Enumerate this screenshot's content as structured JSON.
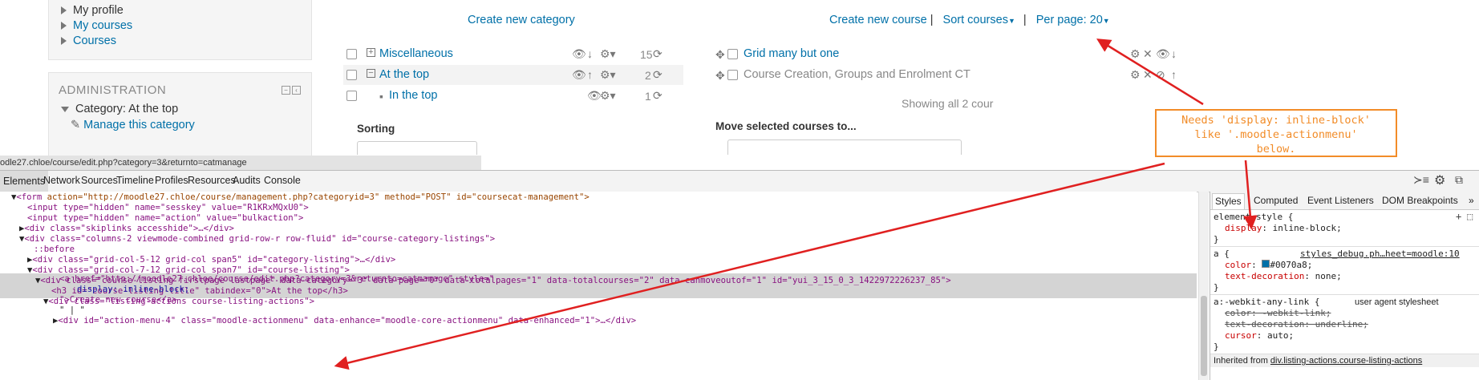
{
  "nav": {
    "items": [
      "My profile",
      "My courses",
      "Courses"
    ]
  },
  "admin": {
    "title": "ADMINISTRATION",
    "category_item": "Category: At the top",
    "manage_link": "Manage this category"
  },
  "categories": {
    "create_link": "Create new category",
    "rows": [
      {
        "name": "Miscellaneous",
        "count": "15"
      },
      {
        "name": "At the top",
        "count": "2"
      },
      {
        "name": "In the top",
        "count": "1"
      }
    ],
    "sorting_label": "Sorting"
  },
  "courses": {
    "create_link": "Create new course",
    "sep1": "|",
    "sort_link": "Sort courses",
    "sep2": "|",
    "perpage_link": "Per page: 20",
    "rows": [
      {
        "name": "Grid many but one"
      },
      {
        "name": "Course Creation, Groups and Enrolment CT"
      }
    ],
    "showing_text": "Showing all 2 cour",
    "move_label": "Move selected courses to..."
  },
  "annotation": {
    "text_line1": "Needs 'display: inline-block'",
    "text_line2": "like '.moodle-actionmenu'",
    "text_line3": "below.",
    "arrow_color": "#e02020",
    "border_color": "#f28c28"
  },
  "devtools": {
    "url": "odle27.chloe/course/edit.php?category=3&returnto=catmanage",
    "tabs": [
      "Elements",
      "Network",
      "Sources",
      "Timeline",
      "Profiles",
      "Resources",
      "Audits",
      "Console"
    ],
    "code": {
      "l1_tag": "<form",
      "l1_attr": " action=\"http://moodle27.chloe/course/management.php?categoryid=3\" method=\"POST\" id=\"coursecat-management\">",
      "l2": "<input type=\"hidden\" name=\"sesskey\" value=\"R1KRxMQxU0\">",
      "l3": "<input type=\"hidden\" name=\"action\" value=\"bulkaction\">",
      "l4": "<div class=\"skiplinks accesshide\">…</div>",
      "l5": "<div class=\"columns-2 viewmode-combined grid-row-r row-fluid\" id=\"course-category-listings\">",
      "l6": "::before",
      "l7": "<div class=\"grid-col-5-12 grid-col span5\" id=\"category-listing\">…</div>",
      "l8": "<div class=\"grid-col-7-12 grid-col span7\" id=\"course-listing\">",
      "l9": "<div class=\"course-listing firstpage lastpage\" data-category=\"3\" data-page=\"0\" data-totalpages=\"1\" data-totalcourses=\"2\" data-canmoveoutof=\"1\" id=\"yui_3_15_0_3_1422972226237_85\">",
      "l10": "<h3 id=\"course-listing-title\" tabindex=\"0\">At the top</h3>",
      "l11": "<div class=\"listing-actions course-listing-actions\">",
      "l12": "<a href=\"http://moodle27.chloe/course/edit.php?category=3&returnto=catmanage\" style=\"",
      "l13": "display: inline-block;",
      "l14": "\">Create new course</a>",
      "l15": "\" | \"",
      "l16": "<div id=\"action-menu-4\" class=\"moodle-actionmenu\" data-enhance=\"moodle-core-actionmenu\" data-enhanced=\"1\">…</div>"
    },
    "styles": {
      "tabs": [
        "Styles",
        "Computed",
        "Event Listeners",
        "DOM Breakpoints"
      ],
      "element_style": "element.style {",
      "display_prop": "display",
      "display_val": ": inline-block;",
      "a_rule": "a {",
      "a_source": "styles_debug.ph…heet=moodle:10",
      "color_prop": "color",
      "color_val": "#0070a8;",
      "text_dec": "text-decoration",
      "text_dec_val": ": none;",
      "close": "}",
      "webkit_rule": "a:-webkit-any-link {",
      "webkit_source": "user agent stylesheet",
      "wk_color": "color: -webkit-link;",
      "wk_td": "text-decoration: underline;",
      "wk_cursor": "cursor",
      "wk_cursor_val": ": auto;",
      "inherited": "Inherited from ",
      "inherited_link": "div.listing-actions.course-listing-actions"
    }
  }
}
